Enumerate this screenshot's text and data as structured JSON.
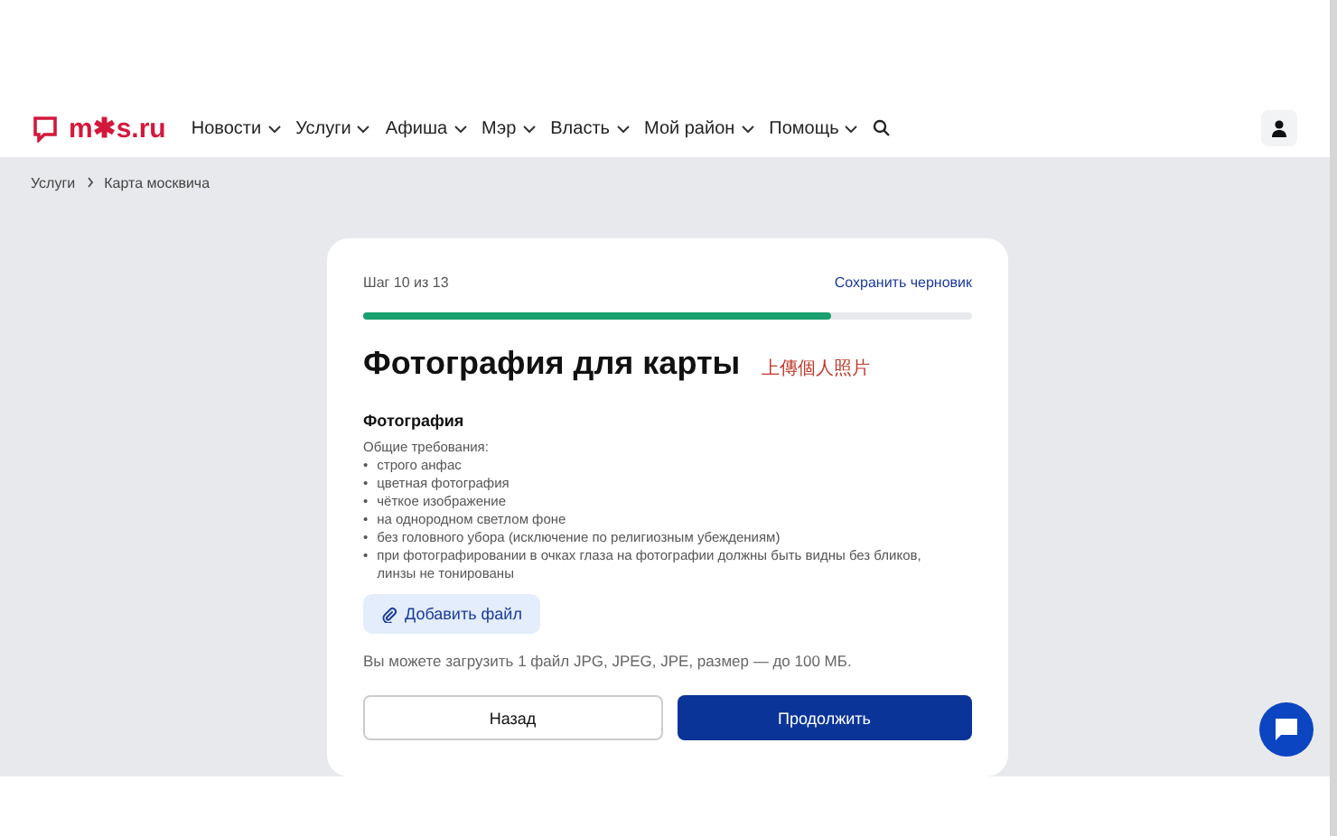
{
  "header": {
    "logo": "m✱s.ru",
    "nav": [
      {
        "label": "Новости"
      },
      {
        "label": "Услуги"
      },
      {
        "label": "Афиша"
      },
      {
        "label": "Мэр"
      },
      {
        "label": "Власть"
      },
      {
        "label": "Мой район"
      },
      {
        "label": "Помощь"
      }
    ]
  },
  "breadcrumbs": [
    "Услуги",
    "Карта москвича"
  ],
  "form": {
    "step": "Шаг 10 из 13",
    "save_draft": "Сохранить черновик",
    "progress": {
      "level": 0.77
    },
    "title": "Фотография для карты",
    "note": "上傳個人照片",
    "section": "Фотография",
    "requirements_title": "Общие требования:",
    "requirements": [
      {
        "marker": "•",
        "text": "строго анфас"
      },
      {
        "marker": "•",
        "text": "цветная фотография"
      },
      {
        "marker": "•",
        "text": "чёткое изображение"
      },
      {
        "marker": "•",
        "text": "на однородном светлом фоне"
      },
      {
        "marker": "•",
        "text": "без головного убора (исключение по религиозным убеждениям)"
      },
      {
        "marker": "•",
        "text": "при фотографировании в очках глаза на фотографии должны быть видны без бликов, линзы не тонированы"
      }
    ],
    "add_file": "Добавить файл",
    "hint": "Вы можете загрузить 1 файл JPG, JPEG, JPE, размер — до 100 МБ.",
    "back": "Назад",
    "next": "Продолжить"
  }
}
